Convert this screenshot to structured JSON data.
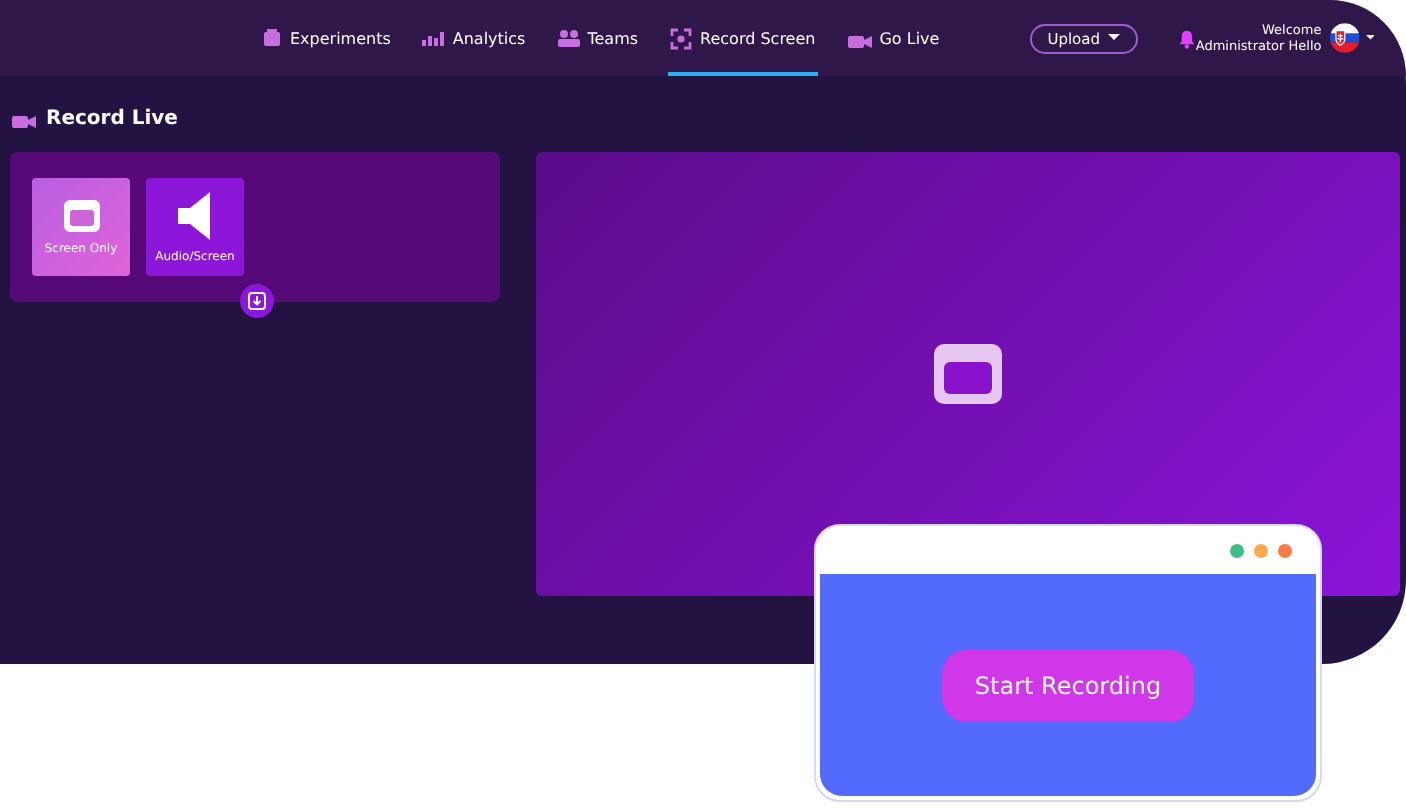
{
  "nav": {
    "tabs": [
      {
        "label": "Experiments",
        "selected": false
      },
      {
        "label": "Analytics",
        "selected": false
      },
      {
        "label": "Teams",
        "selected": false
      },
      {
        "label": "Record Screen",
        "selected": true
      },
      {
        "label": "Go Live",
        "selected": false
      }
    ],
    "upload": "Upload",
    "user": {
      "greeting": "Welcome",
      "name": "Administrator Hello"
    }
  },
  "section": {
    "title": "Record Live"
  },
  "options": [
    {
      "label": "Screen Only",
      "selected": true
    },
    {
      "label": "Audio/Screen",
      "selected": false
    }
  ],
  "popup": {
    "dots": [
      {
        "color": "#3dbe83"
      },
      {
        "color": "#ffa94d"
      },
      {
        "color": "#ff7a45"
      }
    ],
    "button": "Start Recording"
  }
}
